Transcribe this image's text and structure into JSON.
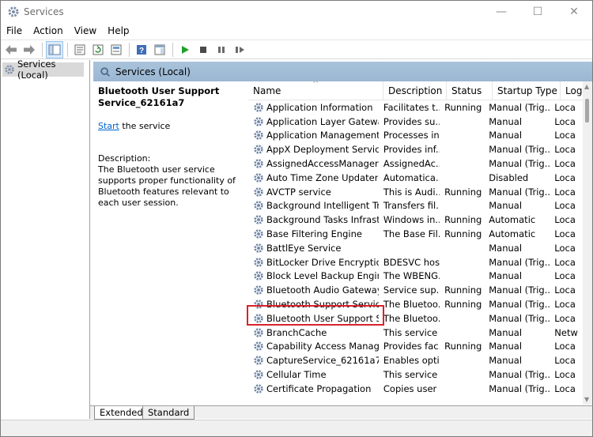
{
  "window": {
    "title": "Services",
    "controls": {
      "minimize": "—",
      "maximize": "☐",
      "close": "✕"
    }
  },
  "menu": [
    {
      "label": "File"
    },
    {
      "label": "Action"
    },
    {
      "label": "View"
    },
    {
      "label": "Help"
    }
  ],
  "tree": {
    "root": "Services (Local)"
  },
  "header": {
    "title": "Services (Local)"
  },
  "selected": {
    "name": "Bluetooth User Support Service_62161a7",
    "start_link": "Start",
    "start_suffix": " the service",
    "description_label": "Description:",
    "description_text": "The Bluetooth user service supports proper functionality of Bluetooth features relevant to each user session."
  },
  "columns": {
    "name": "Name",
    "description": "Description",
    "status": "Status",
    "startup": "Startup Type",
    "log": "Log"
  },
  "services": [
    {
      "name": "Application Information",
      "description": "Facilitates t...",
      "status": "Running",
      "startup": "Manual (Trig...",
      "log": "Loca"
    },
    {
      "name": "Application Layer Gateway ...",
      "description": "Provides su...",
      "status": "",
      "startup": "Manual",
      "log": "Loca"
    },
    {
      "name": "Application Management",
      "description": "Processes in...",
      "status": "",
      "startup": "Manual",
      "log": "Loca"
    },
    {
      "name": "AppX Deployment Service (...",
      "description": "Provides inf...",
      "status": "",
      "startup": "Manual (Trig...",
      "log": "Loca"
    },
    {
      "name": "AssignedAccessManager Se...",
      "description": "AssignedAc...",
      "status": "",
      "startup": "Manual (Trig...",
      "log": "Loca"
    },
    {
      "name": "Auto Time Zone Updater",
      "description": "Automatica...",
      "status": "",
      "startup": "Disabled",
      "log": "Loca"
    },
    {
      "name": "AVCTP service",
      "description": "This is Audi...",
      "status": "Running",
      "startup": "Manual (Trig...",
      "log": "Loca"
    },
    {
      "name": "Background Intelligent Tran...",
      "description": "Transfers fil...",
      "status": "",
      "startup": "Manual",
      "log": "Loca"
    },
    {
      "name": "Background Tasks Infrastruc...",
      "description": "Windows in...",
      "status": "Running",
      "startup": "Automatic",
      "log": "Loca"
    },
    {
      "name": "Base Filtering Engine",
      "description": "The Base Fil...",
      "status": "Running",
      "startup": "Automatic",
      "log": "Loca"
    },
    {
      "name": "BattlEye Service",
      "description": "",
      "status": "",
      "startup": "Manual",
      "log": "Loca"
    },
    {
      "name": "BitLocker Drive Encryption ...",
      "description": "BDESVC hos...",
      "status": "",
      "startup": "Manual (Trig...",
      "log": "Loca"
    },
    {
      "name": "Block Level Backup Engine ...",
      "description": "The WBENG...",
      "status": "",
      "startup": "Manual",
      "log": "Loca"
    },
    {
      "name": "Bluetooth Audio Gateway S...",
      "description": "Service sup...",
      "status": "Running",
      "startup": "Manual (Trig...",
      "log": "Loca"
    },
    {
      "name": "Bluetooth Support Service",
      "description": "The Bluetoo...",
      "status": "Running",
      "startup": "Manual (Trig...",
      "log": "Loca"
    },
    {
      "name": "Bluetooth User Support Ser...",
      "description": "The Bluetoo...",
      "status": "",
      "startup": "Manual (Trig...",
      "log": "Loca"
    },
    {
      "name": "BranchCache",
      "description": "This service ...",
      "status": "",
      "startup": "Manual",
      "log": "Netw"
    },
    {
      "name": "Capability Access Manager ...",
      "description": "Provides fac...",
      "status": "Running",
      "startup": "Manual",
      "log": "Loca"
    },
    {
      "name": "CaptureService_62161a7",
      "description": "Enables opti...",
      "status": "",
      "startup": "Manual",
      "log": "Loca"
    },
    {
      "name": "Cellular Time",
      "description": "This service ...",
      "status": "",
      "startup": "Manual (Trig...",
      "log": "Loca"
    },
    {
      "name": "Certificate Propagation",
      "description": "Copies user ...",
      "status": "",
      "startup": "Manual (Trig...",
      "log": "Loca"
    }
  ],
  "tabs": [
    {
      "label": "Extended"
    },
    {
      "label": "Standard"
    }
  ],
  "colors": {
    "header_bg": "#9ab7d3",
    "highlight_border": "#d8222a",
    "link": "#0066cc"
  }
}
